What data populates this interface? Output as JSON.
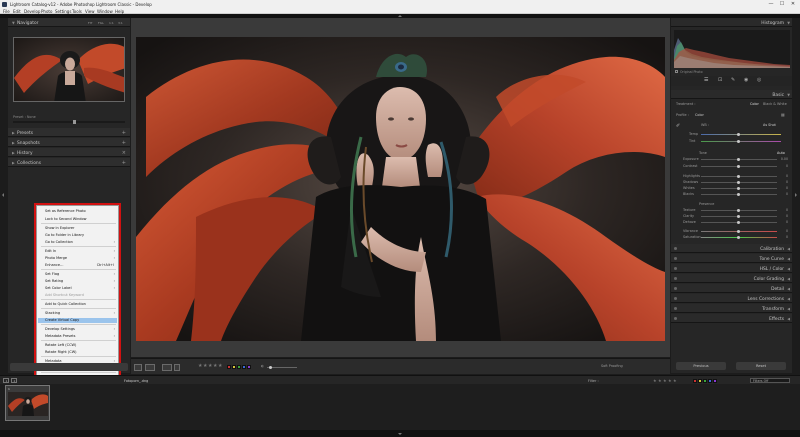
{
  "window": {
    "title": "Lightroom Catalog-v12 - Adobe Photoshop Lightroom Classic - Develop",
    "minimize": "—",
    "maximize": "☐",
    "close": "✕"
  },
  "menubar": [
    "File",
    "Edit",
    "Develop",
    "Photo",
    "Settings",
    "Tools",
    "View",
    "Window",
    "Help"
  ],
  "left_panel": {
    "navigator": {
      "label": "Navigator",
      "zoom_options": [
        "FIT",
        "FILL",
        "1:1",
        "3:1"
      ]
    },
    "preset_label": "Preset : None",
    "sections": [
      "Presets",
      "Snapshots",
      "History",
      "Collections"
    ]
  },
  "context_menu": {
    "items": [
      {
        "label": "Set as Reference Photo"
      },
      {
        "label": "Lock to Second Window"
      },
      {
        "label": "Show in Explorer"
      },
      {
        "label": "Go to Folder in Library"
      },
      {
        "label": "Go to Collection",
        "arrow": "›"
      },
      {
        "label": "Edit In",
        "arrow": "›"
      },
      {
        "label": "Photo Merge",
        "arrow": "›"
      },
      {
        "label": "Enhance...",
        "shortcut": "Ctrl+Alt+I"
      },
      {
        "label": "Set Flag",
        "arrow": "›"
      },
      {
        "label": "Set Rating",
        "arrow": "›"
      },
      {
        "label": "Set Color Label",
        "arrow": "›"
      },
      {
        "label": "Add Shortcut Keyword",
        "disabled": true
      },
      {
        "label": "Add to Quick Collection"
      },
      {
        "label": "Stacking",
        "arrow": "›"
      },
      {
        "label": "Create Virtual Copy",
        "highlighted": true
      },
      {
        "label": "Develop Settings",
        "arrow": "›"
      },
      {
        "label": "Metadata Presets",
        "arrow": "›"
      },
      {
        "label": "Rotate Left (CCW)"
      },
      {
        "label": "Rotate Right (CW)"
      },
      {
        "label": "Metadata",
        "arrow": "›"
      },
      {
        "label": "Export",
        "arrow": "›"
      },
      {
        "label": "Email Photo..."
      },
      {
        "label": "Remove Photo..."
      },
      {
        "label": "View Options",
        "arrow": "›"
      }
    ]
  },
  "right_panel": {
    "histogram_label": "Histogram",
    "original_photo": "Original Photo",
    "basic_label": "Basic",
    "treatment": {
      "label": "Treatment :",
      "options": [
        "Color",
        "Black & White"
      ]
    },
    "profile": {
      "label": "Profile :",
      "value": "Color"
    },
    "wb": {
      "label": "WB :",
      "value": "As Shot"
    },
    "temp": "Temp",
    "tint": "Tint",
    "tone": {
      "label": "Tone",
      "auto": "Auto"
    },
    "tone_sliders": [
      {
        "label": "Exposure",
        "value": "0.00"
      },
      {
        "label": "Contrast",
        "value": "0"
      },
      {
        "label": "Highlights",
        "value": "0"
      },
      {
        "label": "Shadows",
        "value": "0"
      },
      {
        "label": "Whites",
        "value": "0"
      },
      {
        "label": "Blacks",
        "value": "0"
      }
    ],
    "presence": "Presence",
    "presence_sliders": [
      {
        "label": "Texture",
        "value": "0"
      },
      {
        "label": "Clarity",
        "value": "0"
      },
      {
        "label": "Dehaze",
        "value": "0"
      },
      {
        "label": "Vibrance",
        "value": "0"
      },
      {
        "label": "Saturation",
        "value": "0"
      }
    ],
    "sections": [
      "Calibration",
      "Tone Curve",
      "HSL / Color",
      "Color Grading",
      "Detail",
      "Lens Corrections",
      "Transform",
      "Effects"
    ],
    "previous_button": "Previous",
    "reset_button": "Reset"
  },
  "toolbar": {
    "soft_proofing": "Soft Proofing"
  },
  "filmstrip": {
    "page1": "1",
    "page2": "2",
    "filename": "Fotoporn_.dng",
    "filter_label": "Filter :",
    "filter_preset": "Filters Off",
    "thumb_index": "1"
  },
  "colors": {
    "flags": [
      "#c83232",
      "#d4c23a",
      "#3aa63a",
      "#3a6ad4",
      "#8a3ad4"
    ],
    "highlight": "#9bc4ec",
    "accent": "#d11111"
  }
}
